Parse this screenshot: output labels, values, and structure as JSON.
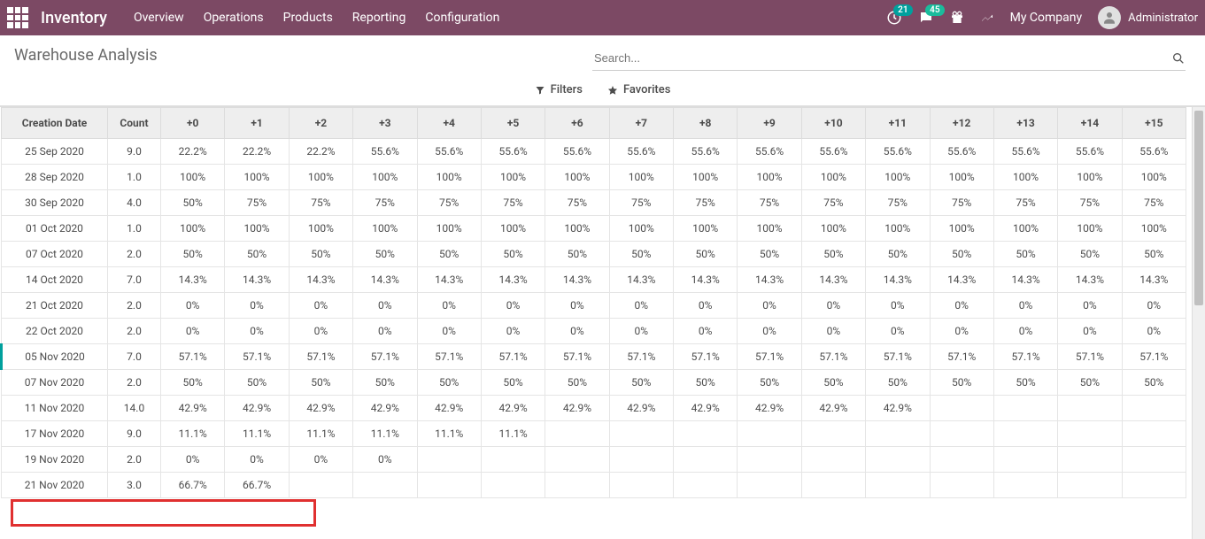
{
  "navbar": {
    "app_name": "Inventory",
    "menus": [
      "Overview",
      "Operations",
      "Products",
      "Reporting",
      "Configuration"
    ],
    "clock_badge": "21",
    "chat_badge": "45",
    "company": "My Company",
    "user": "Administrator"
  },
  "control_panel": {
    "title": "Warehouse Analysis",
    "search_placeholder": "Search...",
    "filters_label": "Filters",
    "favorites_label": "Favorites"
  },
  "table": {
    "headers": [
      "Creation Date",
      "Count",
      "+0",
      "+1",
      "+2",
      "+3",
      "+4",
      "+5",
      "+6",
      "+7",
      "+8",
      "+9",
      "+10",
      "+11",
      "+12",
      "+13",
      "+14",
      "+15"
    ],
    "rows": [
      {
        "date": "25 Sep 2020",
        "count": "9.0",
        "vals": [
          "22.2%",
          "22.2%",
          "22.2%",
          "55.6%",
          "55.6%",
          "55.6%",
          "55.6%",
          "55.6%",
          "55.6%",
          "55.6%",
          "55.6%",
          "55.6%",
          "55.6%",
          "55.6%",
          "55.6%",
          "55.6%"
        ]
      },
      {
        "date": "28 Sep 2020",
        "count": "1.0",
        "vals": [
          "100%",
          "100%",
          "100%",
          "100%",
          "100%",
          "100%",
          "100%",
          "100%",
          "100%",
          "100%",
          "100%",
          "100%",
          "100%",
          "100%",
          "100%",
          "100%"
        ]
      },
      {
        "date": "30 Sep 2020",
        "count": "4.0",
        "vals": [
          "50%",
          "75%",
          "75%",
          "75%",
          "75%",
          "75%",
          "75%",
          "75%",
          "75%",
          "75%",
          "75%",
          "75%",
          "75%",
          "75%",
          "75%",
          "75%"
        ]
      },
      {
        "date": "01 Oct 2020",
        "count": "1.0",
        "vals": [
          "100%",
          "100%",
          "100%",
          "100%",
          "100%",
          "100%",
          "100%",
          "100%",
          "100%",
          "100%",
          "100%",
          "100%",
          "100%",
          "100%",
          "100%",
          "100%"
        ]
      },
      {
        "date": "07 Oct 2020",
        "count": "2.0",
        "vals": [
          "50%",
          "50%",
          "50%",
          "50%",
          "50%",
          "50%",
          "50%",
          "50%",
          "50%",
          "50%",
          "50%",
          "50%",
          "50%",
          "50%",
          "50%",
          "50%"
        ]
      },
      {
        "date": "14 Oct 2020",
        "count": "7.0",
        "vals": [
          "14.3%",
          "14.3%",
          "14.3%",
          "14.3%",
          "14.3%",
          "14.3%",
          "14.3%",
          "14.3%",
          "14.3%",
          "14.3%",
          "14.3%",
          "14.3%",
          "14.3%",
          "14.3%",
          "14.3%",
          "14.3%"
        ]
      },
      {
        "date": "21 Oct 2020",
        "count": "2.0",
        "vals": [
          "0%",
          "0%",
          "0%",
          "0%",
          "0%",
          "0%",
          "0%",
          "0%",
          "0%",
          "0%",
          "0%",
          "0%",
          "0%",
          "0%",
          "0%",
          "0%"
        ]
      },
      {
        "date": "22 Oct 2020",
        "count": "2.0",
        "vals": [
          "0%",
          "0%",
          "0%",
          "0%",
          "0%",
          "0%",
          "0%",
          "0%",
          "0%",
          "0%",
          "0%",
          "0%",
          "0%",
          "0%",
          "0%",
          "0%"
        ]
      },
      {
        "date": "05 Nov 2020",
        "count": "7.0",
        "vals": [
          "57.1%",
          "57.1%",
          "57.1%",
          "57.1%",
          "57.1%",
          "57.1%",
          "57.1%",
          "57.1%",
          "57.1%",
          "57.1%",
          "57.1%",
          "57.1%",
          "57.1%",
          "57.1%",
          "57.1%",
          "57.1%"
        ],
        "highlight": true
      },
      {
        "date": "07 Nov 2020",
        "count": "2.0",
        "vals": [
          "50%",
          "50%",
          "50%",
          "50%",
          "50%",
          "50%",
          "50%",
          "50%",
          "50%",
          "50%",
          "50%",
          "50%",
          "50%",
          "50%",
          "50%",
          "50%"
        ]
      },
      {
        "date": "11 Nov 2020",
        "count": "14.0",
        "vals": [
          "42.9%",
          "42.9%",
          "42.9%",
          "42.9%",
          "42.9%",
          "42.9%",
          "42.9%",
          "42.9%",
          "42.9%",
          "42.9%",
          "42.9%",
          "42.9%",
          "",
          "",
          "",
          ""
        ]
      },
      {
        "date": "17 Nov 2020",
        "count": "9.0",
        "vals": [
          "11.1%",
          "11.1%",
          "11.1%",
          "11.1%",
          "11.1%",
          "11.1%",
          "",
          "",
          "",
          "",
          "",
          "",
          "",
          "",
          "",
          ""
        ]
      },
      {
        "date": "19 Nov 2020",
        "count": "2.0",
        "vals": [
          "0%",
          "0%",
          "0%",
          "0%",
          "",
          "",
          "",
          "",
          "",
          "",
          "",
          "",
          "",
          "",
          "",
          ""
        ]
      },
      {
        "date": "21 Nov 2020",
        "count": "3.0",
        "vals": [
          "66.7%",
          "66.7%",
          "",
          "",
          "",
          "",
          "",
          "",
          "",
          "",
          "",
          "",
          "",
          "",
          "",
          ""
        ],
        "redbox": true
      }
    ]
  }
}
